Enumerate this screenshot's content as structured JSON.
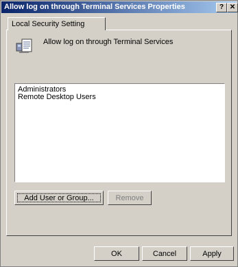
{
  "window": {
    "title": "Allow log on through Terminal Services Properties",
    "help_glyph": "?",
    "close_glyph": "✕"
  },
  "tabs": [
    {
      "label": "Local Security Setting"
    }
  ],
  "policy": {
    "icon": "policy-document-icon",
    "label": "Allow log on through Terminal Services"
  },
  "members": [
    "Administrators",
    "Remote Desktop Users"
  ],
  "buttons": {
    "add": "Add User or Group...",
    "remove": "Remove",
    "ok": "OK",
    "cancel": "Cancel",
    "apply": "Apply"
  }
}
